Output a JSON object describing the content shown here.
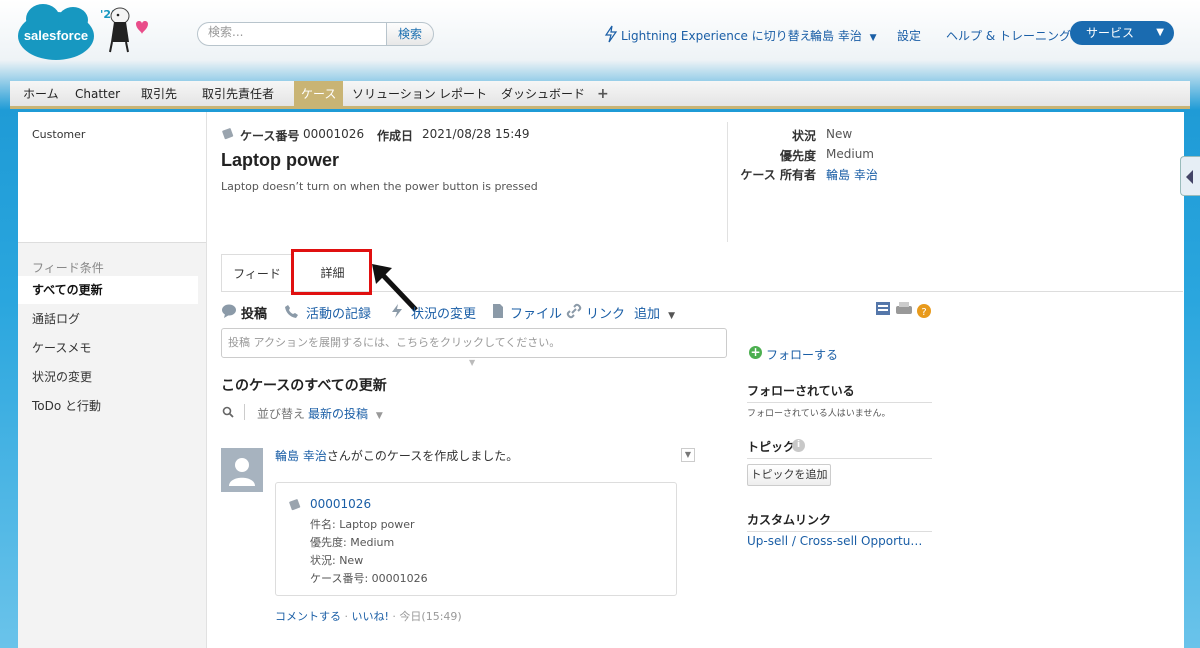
{
  "brand": {
    "logo_text": "salesforce",
    "year": "'21"
  },
  "search": {
    "placeholder": "検索...",
    "button": "検索"
  },
  "top_links": {
    "lightning": "Lightning Experience に切り替え",
    "user": "輪島 幸治",
    "settings": "設定",
    "help": "ヘルプ & トレーニング",
    "app": "サービス"
  },
  "tabs": [
    "ホーム",
    "Chatter",
    "取引先",
    "取引先責任者",
    "ケース",
    "ソリューション",
    "レポート",
    "ダッシュボード",
    "+"
  ],
  "left_top": {
    "customer": "Customer"
  },
  "case": {
    "number_label": "ケース番号",
    "number": "00001026",
    "created_label": "作成日",
    "created": "2021/08/28 15:49",
    "title": "Laptop power",
    "description": "Laptop doesn’t turn on when the power button is pressed"
  },
  "case_fields": {
    "status_label": "状況",
    "status": "New",
    "priority_label": "優先度",
    "priority": "Medium",
    "owner_label": "ケース 所有者",
    "owner": "輪島 幸治"
  },
  "feed_filter": {
    "title": "フィード条件",
    "items": [
      "すべての更新",
      "通話ログ",
      "ケースメモ",
      "状況の変更",
      "ToDo と行動"
    ]
  },
  "feed_tabs": {
    "feed": "フィード",
    "detail": "詳細"
  },
  "actions": [
    "投稿",
    "活動の記録",
    "状況の変更",
    "ファイル",
    "リンク",
    "追加"
  ],
  "post_placeholder": "投稿 アクションを展開するには、こちらをクリックしてください。",
  "updates": {
    "title": "このケースのすべての更新",
    "sort_label": "並び替え",
    "sort_value": "最新の投稿"
  },
  "post": {
    "author": "輪島 幸治",
    "text": "さんがこのケースを作成しました。",
    "card": {
      "id": "00001026",
      "subject": "件名: Laptop power",
      "priority": "優先度: Medium",
      "status": "状況: New",
      "number": "ケース番号: 00001026"
    },
    "comment": "コメントする",
    "like": "いいね!",
    "time": "今日(15:49)"
  },
  "right": {
    "follow": "フォローする",
    "followers_title": "フォローされている",
    "followers_note": "フォローされている人はいません。",
    "topics_title": "トピック",
    "add_topic": "トピックを追加",
    "custom_links_title": "カスタムリンク",
    "custom_link": "Up-sell / Cross-sell Opportu…"
  },
  "colors": {
    "accent_link": "#1a5ea6",
    "tab_active": "#c9b474",
    "highlight": "#e01010",
    "app_button": "#1a6bb0"
  }
}
